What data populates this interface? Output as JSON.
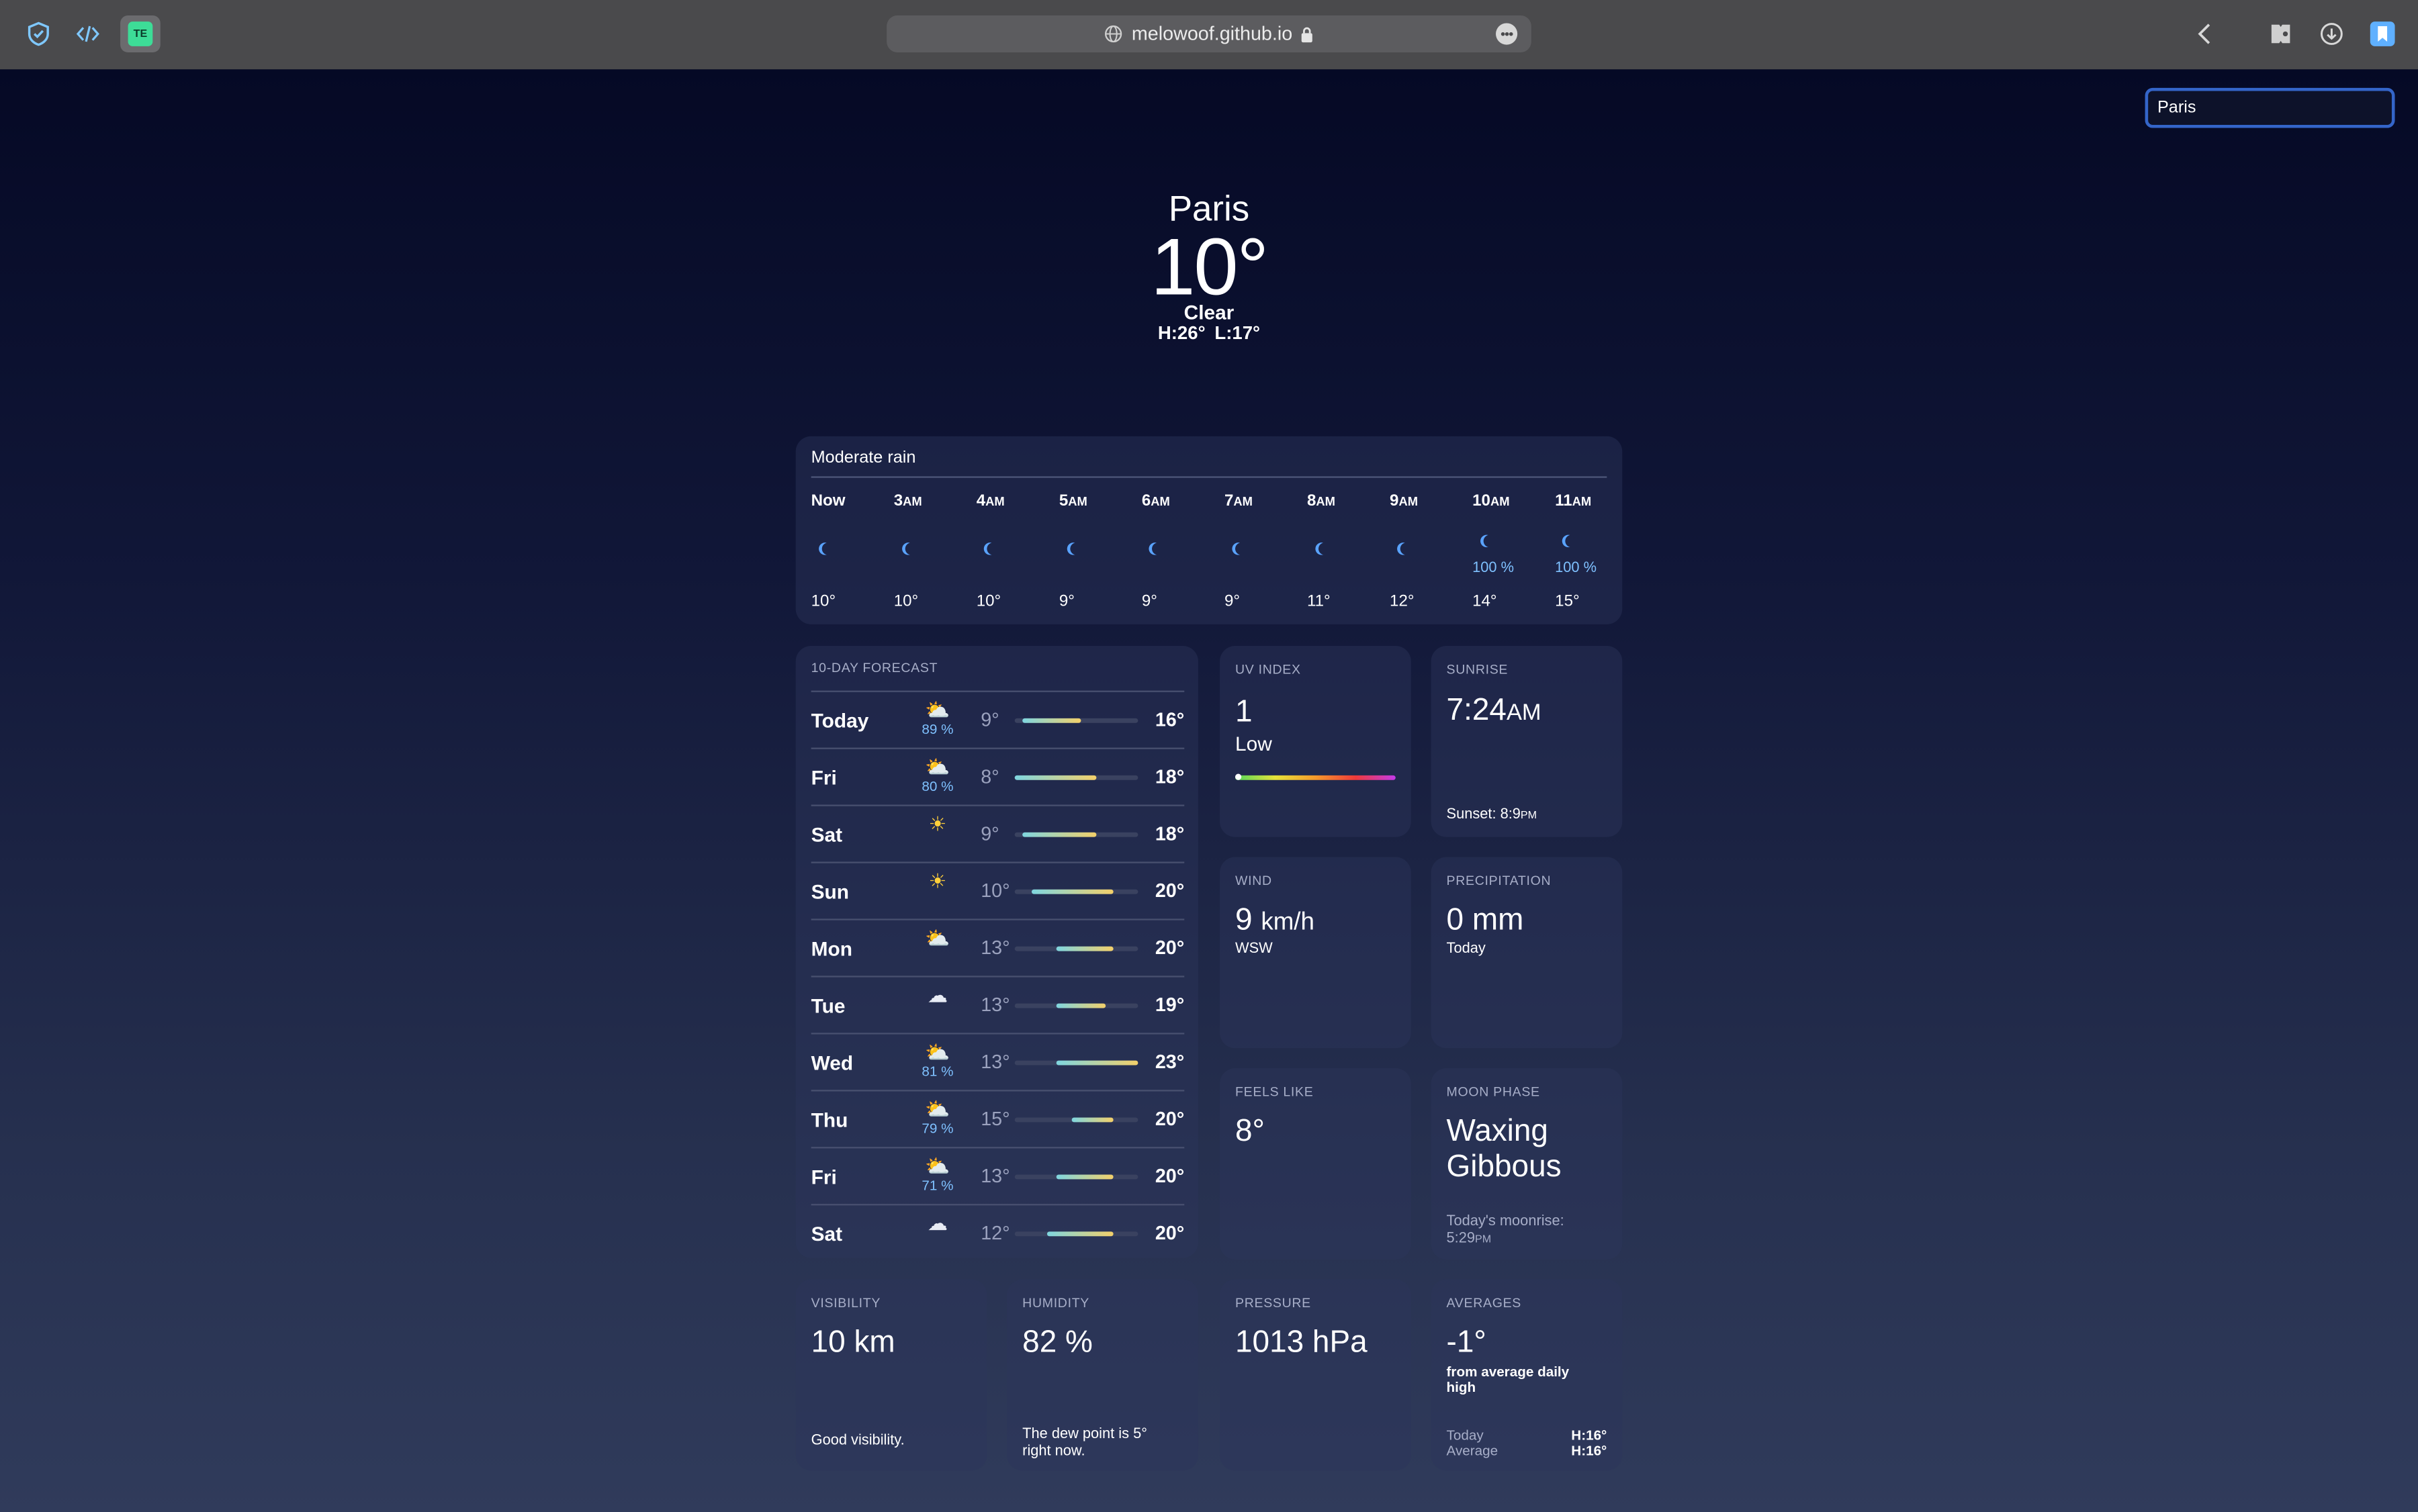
{
  "browser": {
    "url": "melowoof.github.io",
    "extension_label": "TE"
  },
  "search": {
    "value": "Paris"
  },
  "current": {
    "city": "Paris",
    "temp": "10°",
    "condition": "Clear",
    "high": "H:26°",
    "low": "L:17°"
  },
  "hourly": {
    "summary": "Moderate rain",
    "hours": [
      {
        "time": "Now",
        "ampm": "",
        "precip": "",
        "temp": "10°"
      },
      {
        "time": "3",
        "ampm": "AM",
        "precip": "",
        "temp": "10°"
      },
      {
        "time": "4",
        "ampm": "AM",
        "precip": "",
        "temp": "10°"
      },
      {
        "time": "5",
        "ampm": "AM",
        "precip": "",
        "temp": "9°"
      },
      {
        "time": "6",
        "ampm": "AM",
        "precip": "",
        "temp": "9°"
      },
      {
        "time": "7",
        "ampm": "AM",
        "precip": "",
        "temp": "9°"
      },
      {
        "time": "8",
        "ampm": "AM",
        "precip": "",
        "temp": "11°"
      },
      {
        "time": "9",
        "ampm": "AM",
        "precip": "",
        "temp": "12°"
      },
      {
        "time": "10",
        "ampm": "AM",
        "precip": "100 %",
        "temp": "14°"
      },
      {
        "time": "11",
        "ampm": "AM",
        "precip": "100 %",
        "temp": "15°"
      }
    ]
  },
  "forecast": {
    "label": "10-DAY FORECAST",
    "days": [
      {
        "day": "Today",
        "icon": "partly-cloudy-rain-icon",
        "precip": "89 %",
        "low": "9°",
        "high": "16°",
        "low_value": 9,
        "high_value": 16
      },
      {
        "day": "Fri",
        "icon": "partly-cloudy-rain-icon",
        "precip": "80 %",
        "low": "8°",
        "high": "18°",
        "low_value": 8,
        "high_value": 18
      },
      {
        "day": "Sat",
        "icon": "sun-icon",
        "precip": "",
        "low": "9°",
        "high": "18°",
        "low_value": 9,
        "high_value": 18
      },
      {
        "day": "Sun",
        "icon": "sun-icon",
        "precip": "",
        "low": "10°",
        "high": "20°",
        "low_value": 10,
        "high_value": 20
      },
      {
        "day": "Mon",
        "icon": "partly-cloudy-icon",
        "precip": "",
        "low": "13°",
        "high": "20°",
        "low_value": 13,
        "high_value": 20
      },
      {
        "day": "Tue",
        "icon": "cloud-icon",
        "precip": "",
        "low": "13°",
        "high": "19°",
        "low_value": 13,
        "high_value": 19
      },
      {
        "day": "Wed",
        "icon": "partly-cloudy-rain-icon",
        "precip": "81 %",
        "low": "13°",
        "high": "23°",
        "low_value": 13,
        "high_value": 23
      },
      {
        "day": "Thu",
        "icon": "partly-cloudy-rain-icon",
        "precip": "79 %",
        "low": "15°",
        "high": "20°",
        "low_value": 15,
        "high_value": 20
      },
      {
        "day": "Fri",
        "icon": "partly-cloudy-rain-icon",
        "precip": "71 %",
        "low": "13°",
        "high": "20°",
        "low_value": 13,
        "high_value": 20
      },
      {
        "day": "Sat",
        "icon": "cloud-icon",
        "precip": "",
        "low": "12°",
        "high": "20°",
        "low_value": 12,
        "high_value": 20
      }
    ]
  },
  "uv": {
    "label": "UV INDEX",
    "value": "1",
    "level": "Low",
    "fraction": 0.0
  },
  "sunrise": {
    "label": "SUNRISE",
    "time": "7:24",
    "ampm": "AM",
    "sunset_label": "Sunset: 8:9",
    "sunset_ampm": "PM"
  },
  "wind": {
    "label": "WIND",
    "speed": "9",
    "unit": "km/h",
    "direction": "WSW"
  },
  "precipitation": {
    "label": "PRECIPITATION",
    "value": "0 mm",
    "period": "Today"
  },
  "feels_like": {
    "label": "FEELS LIKE",
    "value": "8°"
  },
  "moon": {
    "label": "MOON PHASE",
    "phase_line1": "Waxing",
    "phase_line2": "Gibbous",
    "moonrise_label": "Today's moonrise:",
    "moonrise_time": "5:29",
    "moonrise_ampm": "PM"
  },
  "visibility": {
    "label": "VISIBILITY",
    "value": "10 km",
    "note": "Good visibility."
  },
  "humidity": {
    "label": "HUMIDITY",
    "value": "82 %",
    "note_line1": "The dew point is 5°",
    "note_line2": "right now."
  },
  "pressure": {
    "label": "PRESSURE",
    "value": "1013 hPa"
  },
  "averages": {
    "label": "AVERAGES",
    "value": "-1°",
    "note": "from average daily high",
    "today_label": "Today",
    "today_value": "H:16°",
    "average_label": "Average",
    "average_value": "H:16°"
  },
  "colors": {
    "accent": "#3465c9",
    "precip_text": "#7fc1ff",
    "moon_icon": "#5aa3ff"
  }
}
